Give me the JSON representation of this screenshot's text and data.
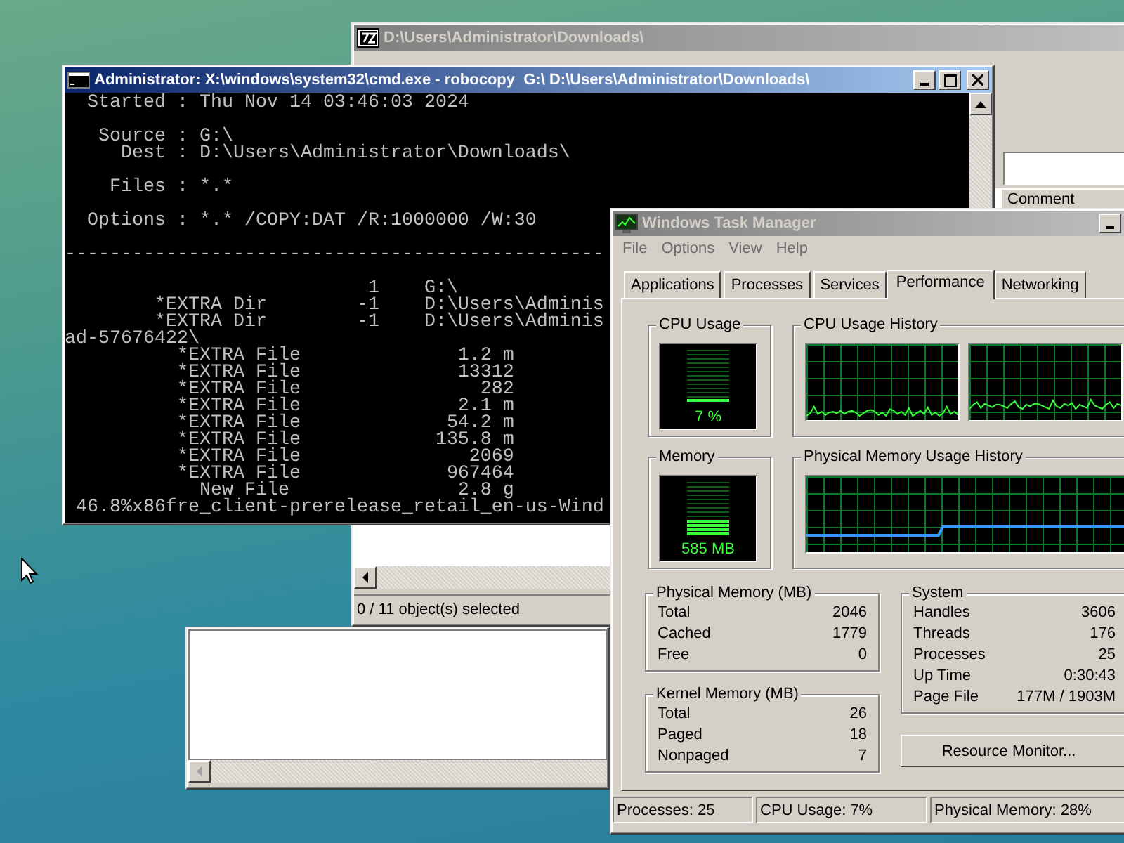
{
  "archive_window": {
    "title": "D:\\Users\\Administrator\\Downloads\\",
    "active": false,
    "list_columns": [
      "Comment"
    ],
    "status": "0 / 11 object(s) selected"
  },
  "console_window": {
    "title": "Administrator: X:\\windows\\system32\\cmd.exe - robocopy  G:\\ D:\\Users\\Administrator\\Downloads\\",
    "active": true,
    "blocks": [
      [
        "  Started : Thu Nov 14 03:46:03 2024"
      ],
      [
        "   Source : G:\\",
        "     Dest : D:\\Users\\Administrator\\Downloads\\"
      ],
      [
        "    Files : *.*"
      ],
      [
        "  Options : *.* /COPY:DAT /R:1000000 /W:30"
      ],
      [
        "------------------------------------------------"
      ],
      [
        "                           1    G:\\",
        "        *EXTRA Dir        -1    D:\\Users\\Adminis",
        "        *EXTRA Dir        -1    D:\\Users\\Adminis",
        "ad-57676422\\",
        "          *EXTRA File              1.2 m",
        "          *EXTRA File              13312",
        "          *EXTRA File                282",
        "          *EXTRA File              2.1 m",
        "          *EXTRA File             54.2 m",
        "          *EXTRA File            135.8 m",
        "          *EXTRA File               2069",
        "          *EXTRA File             967464",
        "            New File               2.8 g",
        " 46.8%x86fre_client-prerelease_retail_en-us-Wind"
      ]
    ]
  },
  "task_manager": {
    "title": "Windows Task Manager",
    "active": false,
    "menu": [
      "File",
      "Options",
      "View",
      "Help"
    ],
    "tabs": [
      {
        "label": "Applications",
        "selected": false
      },
      {
        "label": "Processes",
        "selected": false
      },
      {
        "label": "Services",
        "selected": false
      },
      {
        "label": "Performance",
        "selected": true
      },
      {
        "label": "Networking",
        "selected": false
      }
    ],
    "cpu_usage": {
      "title": "CPU Usage",
      "level": 0.07,
      "reading": "7 %"
    },
    "cpu_history": {
      "title": "CPU Usage History"
    },
    "memory": {
      "title": "Memory",
      "level": 0.28,
      "reading": "585 MB"
    },
    "memory_history": {
      "title": "Physical Memory Usage History"
    },
    "physical_memory": {
      "title": "Physical Memory (MB)",
      "rows": [
        {
          "label": "Total",
          "value": "2046"
        },
        {
          "label": "Cached",
          "value": "1779"
        },
        {
          "label": "Free",
          "value": "0"
        }
      ]
    },
    "kernel_memory": {
      "title": "Kernel Memory (MB)",
      "rows": [
        {
          "label": "Total",
          "value": "26"
        },
        {
          "label": "Paged",
          "value": "18"
        },
        {
          "label": "Nonpaged",
          "value": "7"
        }
      ]
    },
    "system": {
      "title": "System",
      "rows": [
        {
          "label": "Handles",
          "value": "3606"
        },
        {
          "label": "Threads",
          "value": "176"
        },
        {
          "label": "Processes",
          "value": "25"
        },
        {
          "label": "Up Time",
          "value": "0:30:43"
        },
        {
          "label": "Page File",
          "value": "177M / 1903M"
        }
      ]
    },
    "resource_monitor_button": "Resource Monitor...",
    "status_bar": [
      "Processes: 25",
      "CPU Usage: 7%",
      "Physical Memory: 28%"
    ]
  }
}
